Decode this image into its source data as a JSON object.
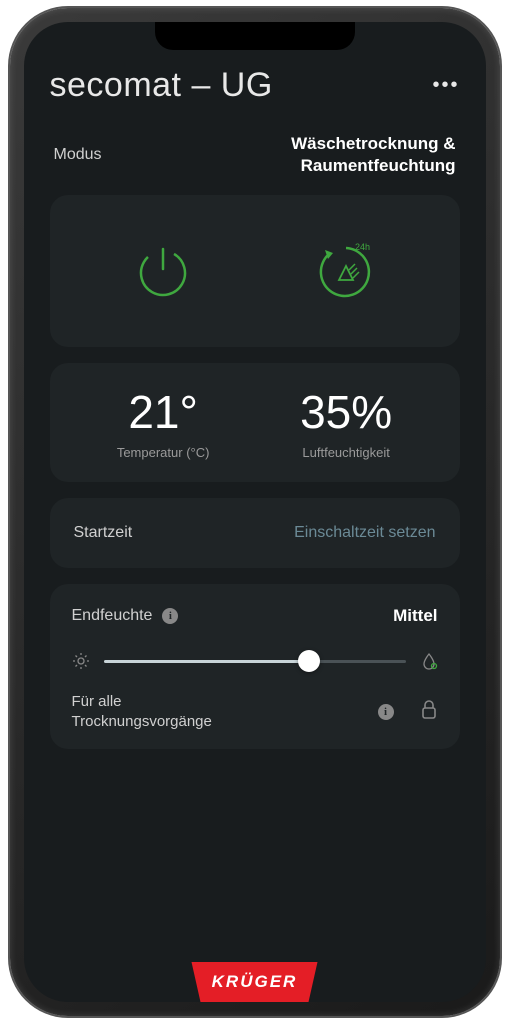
{
  "header": {
    "title": "secomat – UG"
  },
  "mode": {
    "label": "Modus",
    "value_line1": "Wäschetrocknung &",
    "value_line2": "Raumentfeuchtung"
  },
  "icons": {
    "power": "power-icon",
    "cycle": "cycle-24h-icon",
    "cycle_badge": "24h"
  },
  "readings": {
    "temperature": {
      "value": "21°",
      "label": "Temperatur (°C)"
    },
    "humidity": {
      "value": "35%",
      "label": "Luftfeuchtigkeit"
    }
  },
  "timer": {
    "label": "Startzeit",
    "action": "Einschaltzeit setzen"
  },
  "end_humidity": {
    "label": "Endfeuchte",
    "value": "Mittel",
    "slider_percent": 68,
    "all_label_line1": "Für alle",
    "all_label_line2": "Trocknungsvorgänge"
  },
  "brand": "KRÜGER",
  "colors": {
    "accent_green": "#3fa83f",
    "brand_red": "#e41e26",
    "card_bg": "#1f2426",
    "screen_bg": "#181c1e"
  }
}
